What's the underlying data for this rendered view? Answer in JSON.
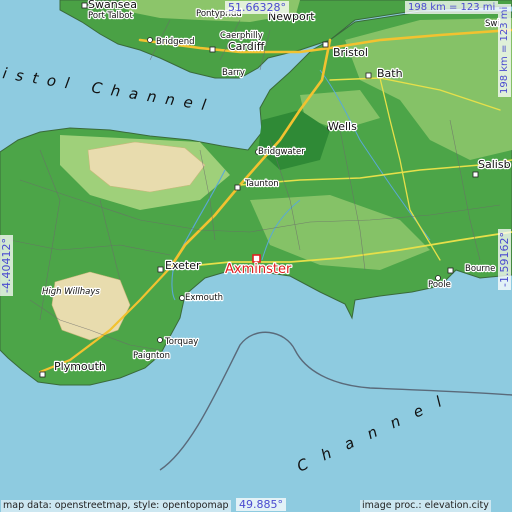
{
  "map": {
    "highlight_place": "Axminster",
    "colors": {
      "sea": "#8ecbe0",
      "lowland": "#3f9d3f",
      "midland": "#8cc56a",
      "upland": "#e8dcae",
      "highlight": "#e02020",
      "coord_text": "#4a4ad0"
    }
  },
  "coordinates": {
    "top": "51.66328°",
    "bottom": "49.885°",
    "left": "-4.40412°",
    "right": "-1.59162°"
  },
  "scale": {
    "label": "198 km = 123 mi"
  },
  "water_labels": {
    "bristol": "istol Channel",
    "channel": "Channel"
  },
  "places": [
    {
      "name": "Swansea",
      "kind": "town"
    },
    {
      "name": "Port Talbot",
      "kind": "small"
    },
    {
      "name": "Pontypridd",
      "kind": "small"
    },
    {
      "name": "Newport",
      "kind": "town"
    },
    {
      "name": "Caerphilly",
      "kind": "small"
    },
    {
      "name": "Bridgend",
      "kind": "small"
    },
    {
      "name": "Cardiff",
      "kind": "town"
    },
    {
      "name": "Barry",
      "kind": "small"
    },
    {
      "name": "Bristol",
      "kind": "town"
    },
    {
      "name": "Bath",
      "kind": "town"
    },
    {
      "name": "Swi",
      "kind": "small"
    },
    {
      "name": "Wells",
      "kind": "town"
    },
    {
      "name": "Bridgwater",
      "kind": "small"
    },
    {
      "name": "Taunton",
      "kind": "small"
    },
    {
      "name": "Salisb",
      "kind": "town"
    },
    {
      "name": "Exeter",
      "kind": "town"
    },
    {
      "name": "Exmouth",
      "kind": "small"
    },
    {
      "name": "High Willhays",
      "kind": "peak"
    },
    {
      "name": "Torquay",
      "kind": "small"
    },
    {
      "name": "Paignton",
      "kind": "small"
    },
    {
      "name": "Plymouth",
      "kind": "town"
    },
    {
      "name": "Poole",
      "kind": "small"
    },
    {
      "name": "Bourne",
      "kind": "small"
    }
  ],
  "credits": {
    "left": "map data: openstreetmap, style: opentopomap",
    "right": "image proc.: elevation.city"
  }
}
